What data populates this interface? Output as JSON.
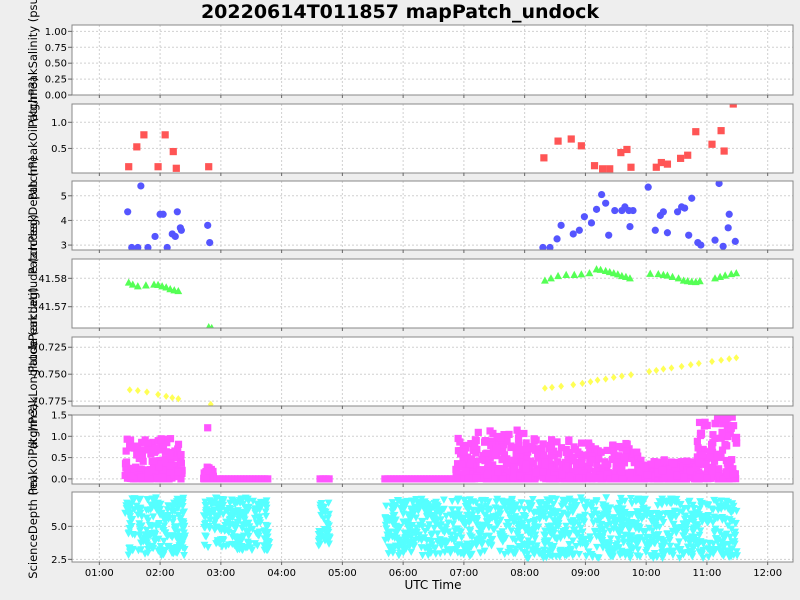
{
  "title": "20220614T011857 mapPatch_undock",
  "xlabel": "UTC Time",
  "colors": {
    "background": "#eeeeee",
    "plot_background": "#ffffff",
    "grid": "#d0d0d0",
    "salinity": "#ff5555",
    "oil_conc": "#ff5555",
    "depth": "#5555ff",
    "latitude": "#55ff55",
    "longitude": "#ffff55",
    "oil_all": "#ff55ff",
    "science_depth": "#55ffff"
  },
  "chart_data": {
    "type": "scatter",
    "x_ticks": [
      "01:00",
      "02:00",
      "03:00",
      "04:00",
      "05:00",
      "06:00",
      "07:00",
      "08:00",
      "09:00",
      "10:00",
      "11:00",
      "12:00"
    ],
    "xlim": [
      "00:33",
      "12:25"
    ],
    "grid": true,
    "panels": [
      {
        "id": "salinity",
        "ylabel": "PatchPeakSalinity (psu)",
        "ylim": [
          0,
          1.1
        ],
        "yticks": [
          0,
          0.25,
          0.5,
          0.75,
          1.0
        ],
        "ytick_labels": [
          "0.00",
          "0.25",
          "0.50",
          "0.75",
          "1.00"
        ],
        "marker": "square",
        "color_key": "salinity",
        "points": []
      },
      {
        "id": "oil",
        "ylabel": "PatchPeakOil (kg/m3)",
        "ylim": [
          0.03,
          1.35
        ],
        "yticks": [
          0.5,
          1.0
        ],
        "ytick_labels": [
          "0.5",
          "1.0"
        ],
        "marker": "square",
        "color_key": "oil_conc",
        "points": [
          [
            "01:29",
            0.15
          ],
          [
            "01:37",
            0.53
          ],
          [
            "01:44",
            0.76
          ],
          [
            "01:58",
            0.15
          ],
          [
            "02:05",
            0.76
          ],
          [
            "02:13",
            0.44
          ],
          [
            "02:16",
            0.12
          ],
          [
            "02:48",
            0.15
          ],
          [
            "08:19",
            0.32
          ],
          [
            "08:33",
            0.64
          ],
          [
            "08:46",
            0.68
          ],
          [
            "08:56",
            0.55
          ],
          [
            "09:09",
            0.17
          ],
          [
            "09:17",
            0.11
          ],
          [
            "09:24",
            0.11
          ],
          [
            "09:35",
            0.42
          ],
          [
            "09:41",
            0.48
          ],
          [
            "09:45",
            0.14
          ],
          [
            "10:10",
            0.14
          ],
          [
            "10:15",
            0.23
          ],
          [
            "10:21",
            0.2
          ],
          [
            "10:34",
            0.31
          ],
          [
            "10:41",
            0.37
          ],
          [
            "10:49",
            0.82
          ],
          [
            "11:05",
            0.58
          ],
          [
            "11:14",
            0.84
          ],
          [
            "11:17",
            0.45
          ],
          [
            "11:26",
            1.35
          ]
        ]
      },
      {
        "id": "depth",
        "ylabel": "PatchPeakDepth (m)",
        "ylim": [
          2.8,
          5.6
        ],
        "yticks": [
          3,
          4,
          5
        ],
        "ytick_labels": [
          "3",
          "4",
          "5"
        ],
        "marker": "circle",
        "color_key": "depth",
        "points": [
          [
            "01:28",
            4.35
          ],
          [
            "01:32",
            2.9
          ],
          [
            "01:38",
            2.9
          ],
          [
            "01:41",
            5.4
          ],
          [
            "01:48",
            2.9
          ],
          [
            "01:55",
            3.35
          ],
          [
            "02:00",
            4.25
          ],
          [
            "02:03",
            4.25
          ],
          [
            "02:07",
            2.9
          ],
          [
            "02:12",
            3.45
          ],
          [
            "02:15",
            3.35
          ],
          [
            "02:17",
            4.35
          ],
          [
            "02:21",
            3.6
          ],
          [
            "02:20",
            3.7
          ],
          [
            "02:47",
            3.8
          ],
          [
            "02:49",
            3.1
          ],
          [
            "08:18",
            2.9
          ],
          [
            "08:25",
            2.9
          ],
          [
            "08:32",
            3.25
          ],
          [
            "08:36",
            3.8
          ],
          [
            "08:48",
            3.45
          ],
          [
            "08:54",
            3.6
          ],
          [
            "08:59",
            4.15
          ],
          [
            "09:06",
            3.9
          ],
          [
            "09:11",
            4.45
          ],
          [
            "09:16",
            5.05
          ],
          [
            "09:20",
            4.7
          ],
          [
            "09:23",
            3.4
          ],
          [
            "09:29",
            4.4
          ],
          [
            "09:36",
            4.4
          ],
          [
            "09:39",
            4.55
          ],
          [
            "09:43",
            4.4
          ],
          [
            "09:44",
            3.75
          ],
          [
            "09:47",
            4.4
          ],
          [
            "10:02",
            5.35
          ],
          [
            "10:09",
            3.6
          ],
          [
            "10:14",
            4.2
          ],
          [
            "10:17",
            4.35
          ],
          [
            "10:21",
            3.5
          ],
          [
            "10:31",
            4.35
          ],
          [
            "10:35",
            4.55
          ],
          [
            "10:38",
            4.5
          ],
          [
            "10:42",
            3.4
          ],
          [
            "10:45",
            4.9
          ],
          [
            "10:51",
            3.1
          ],
          [
            "10:54",
            3.0
          ],
          [
            "11:08",
            3.2
          ],
          [
            "11:12",
            5.5
          ],
          [
            "11:16",
            2.95
          ],
          [
            "11:21",
            3.7
          ],
          [
            "11:22",
            4.25
          ],
          [
            "11:28",
            3.15
          ]
        ]
      },
      {
        "id": "latitude",
        "ylabel": "PatchPeakLatitude (arcdeg)",
        "ylim": [
          41.5625,
          41.5868
        ],
        "yticks": [
          41.57,
          41.58
        ],
        "ytick_labels": [
          "41.57",
          "41.58"
        ],
        "marker": "triangle-up",
        "color_key": "latitude",
        "points": [
          [
            "01:29",
            41.5785
          ],
          [
            "01:33",
            41.5778
          ],
          [
            "01:38",
            41.5772
          ],
          [
            "01:46",
            41.5775
          ],
          [
            "01:54",
            41.5778
          ],
          [
            "01:58",
            41.5777
          ],
          [
            "02:02",
            41.5772
          ],
          [
            "02:06",
            41.5768
          ],
          [
            "02:10",
            41.5762
          ],
          [
            "02:14",
            41.5758
          ],
          [
            "02:18",
            41.5755
          ],
          [
            "02:48",
            41.5628
          ],
          [
            "02:51",
            41.5625
          ],
          [
            "08:20",
            41.5792
          ],
          [
            "08:26",
            41.58
          ],
          [
            "08:33",
            41.5808
          ],
          [
            "08:41",
            41.5812
          ],
          [
            "08:49",
            41.5812
          ],
          [
            "08:56",
            41.5814
          ],
          [
            "09:04",
            41.5818
          ],
          [
            "09:11",
            41.5832
          ],
          [
            "09:15",
            41.583
          ],
          [
            "09:20",
            41.5826
          ],
          [
            "09:24",
            41.5822
          ],
          [
            "09:28",
            41.5818
          ],
          [
            "09:32",
            41.5814
          ],
          [
            "09:36",
            41.5808
          ],
          [
            "09:40",
            41.5805
          ],
          [
            "09:44",
            41.58
          ],
          [
            "10:04",
            41.5816
          ],
          [
            "10:12",
            41.5815
          ],
          [
            "10:17",
            41.5812
          ],
          [
            "10:21",
            41.581
          ],
          [
            "10:26",
            41.5805
          ],
          [
            "10:32",
            41.58
          ],
          [
            "10:37",
            41.5792
          ],
          [
            "10:41",
            41.579
          ],
          [
            "10:45",
            41.5788
          ],
          [
            "10:49",
            41.5787
          ],
          [
            "10:53",
            41.579
          ],
          [
            "11:08",
            41.58
          ],
          [
            "11:13",
            41.5805
          ],
          [
            "11:18",
            41.581
          ],
          [
            "11:24",
            41.5815
          ],
          [
            "11:29",
            41.5818
          ]
        ]
      },
      {
        "id": "longitude",
        "ylabel": "PatchPeakLongitude (arcdeg)",
        "ylim": [
          -70.7795,
          -70.7155
        ],
        "yticks": [
          -70.775,
          -70.75,
          -70.725
        ],
        "ytick_labels": [
          "-70.775",
          "-70.750",
          "-70.725"
        ],
        "marker": "diamond",
        "color_key": "longitude",
        "points": [
          [
            "01:30",
            -70.7645
          ],
          [
            "01:38",
            -70.7652
          ],
          [
            "01:47",
            -70.7665
          ],
          [
            "01:58",
            -70.7688
          ],
          [
            "02:06",
            -70.7705
          ],
          [
            "02:12",
            -70.7718
          ],
          [
            "02:18",
            -70.7728
          ],
          [
            "02:50",
            -70.778
          ],
          [
            "08:20",
            -70.763
          ],
          [
            "08:27",
            -70.7622
          ],
          [
            "08:36",
            -70.7612
          ],
          [
            "08:48",
            -70.7598
          ],
          [
            "08:57",
            -70.7585
          ],
          [
            "09:05",
            -70.757
          ],
          [
            "09:12",
            -70.7555
          ],
          [
            "09:20",
            -70.7545
          ],
          [
            "09:28",
            -70.753
          ],
          [
            "09:36",
            -70.7518
          ],
          [
            "09:45",
            -70.7505
          ],
          [
            "10:03",
            -70.7475
          ],
          [
            "10:10",
            -70.7465
          ],
          [
            "10:17",
            -70.7452
          ],
          [
            "10:25",
            -70.7442
          ],
          [
            "10:35",
            -70.7428
          ],
          [
            "10:44",
            -70.7412
          ],
          [
            "10:52",
            -70.74
          ],
          [
            "11:05",
            -70.7382
          ],
          [
            "11:14",
            -70.737
          ],
          [
            "11:22",
            -70.7358
          ],
          [
            "11:29",
            -70.7348
          ]
        ]
      },
      {
        "id": "oil_all",
        "ylabel": "PeakOil (kg/m3)",
        "ylim": [
          -0.12,
          1.5
        ],
        "yticks": [
          0,
          0.5,
          1.0,
          1.5
        ],
        "ytick_labels": [
          "0.0",
          "0.5",
          "1.0",
          "1.5"
        ],
        "marker": "square",
        "color_key": "oil_all",
        "clusters": [
          {
            "start": "01:25",
            "end": "02:22",
            "ymin": 0.0,
            "ymax": 0.95
          },
          {
            "start": "02:43",
            "end": "02:53",
            "ymin": 0.0,
            "ymax": 0.3
          },
          {
            "start": "06:52",
            "end": "08:00",
            "ymin": 0.0,
            "ymax": 1.15
          },
          {
            "start": "08:00",
            "end": "08:45",
            "ymin": 0.0,
            "ymax": 1.0
          },
          {
            "start": "08:45",
            "end": "09:52",
            "ymin": 0.0,
            "ymax": 0.85
          },
          {
            "start": "09:52",
            "end": "10:50",
            "ymin": 0.0,
            "ymax": 0.45
          },
          {
            "start": "10:50",
            "end": "11:30",
            "ymin": 0.0,
            "ymax": 1.45
          }
        ],
        "flat_segments": [
          {
            "start": "02:53",
            "end": "03:48",
            "y": 0.0
          },
          {
            "start": "04:38",
            "end": "04:48",
            "y": 0.0
          },
          {
            "start": "05:42",
            "end": "06:52",
            "y": 0.0
          }
        ],
        "outliers": [
          [
            "02:47",
            1.2
          ],
          [
            "11:25",
            1.45
          ],
          [
            "11:24",
            1.2
          ]
        ]
      },
      {
        "id": "science_depth",
        "ylabel": "ScienceDepth (m)",
        "ylim": [
          2.3,
          7.6
        ],
        "yticks": [
          2.5,
          5.0
        ],
        "ytick_labels": [
          "2.5",
          "5.0"
        ],
        "marker": "triangle-down",
        "color_key": "science_depth",
        "clusters": [
          {
            "start": "01:25",
            "end": "02:25",
            "ymin": 2.8,
            "ymax": 7.2
          },
          {
            "start": "02:43",
            "end": "03:48",
            "ymin": 3.2,
            "ymax": 7.2
          },
          {
            "start": "04:36",
            "end": "04:48",
            "ymin": 3.5,
            "ymax": 6.8
          },
          {
            "start": "05:42",
            "end": "08:00",
            "ymin": 2.8,
            "ymax": 7.1
          },
          {
            "start": "08:00",
            "end": "09:50",
            "ymin": 2.6,
            "ymax": 7.2
          },
          {
            "start": "09:50",
            "end": "10:55",
            "ymin": 2.6,
            "ymax": 7.1
          },
          {
            "start": "10:55",
            "end": "11:30",
            "ymin": 2.6,
            "ymax": 7.0
          }
        ]
      }
    ]
  }
}
